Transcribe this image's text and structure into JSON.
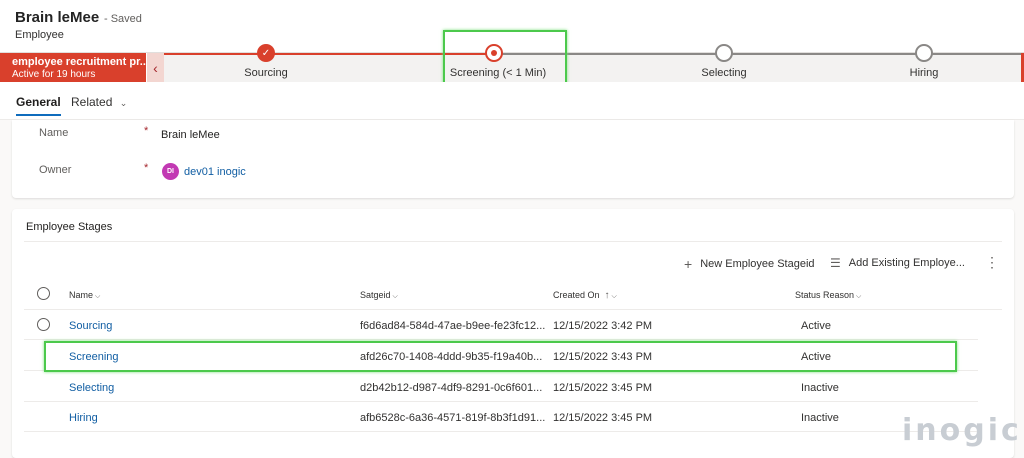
{
  "header": {
    "title": "Brain leMee",
    "saved": "- Saved",
    "entity": "Employee"
  },
  "bpf": {
    "process_name": "employee recruitment pr...",
    "active_for": "Active for 19 hours",
    "stages": [
      {
        "label": "Sourcing",
        "status": "completed"
      },
      {
        "label": "Screening  (< 1 Min)",
        "status": "active"
      },
      {
        "label": "Selecting",
        "status": "pending"
      },
      {
        "label": "Hiring",
        "status": "pending"
      }
    ],
    "colors": {
      "accent": "#d9402c",
      "pending": "#8a8886"
    }
  },
  "tabs": {
    "general": "General",
    "related": "Related"
  },
  "form": {
    "name_label": "Name",
    "name_value": "Brain leMee",
    "owner_label": "Owner",
    "owner_initials": "DI",
    "owner_value": "dev01 inogic",
    "required_mark": "*"
  },
  "subgrid": {
    "title": "Employee Stages",
    "commands": {
      "new": "New Employee Stageid",
      "add_existing": "Add Existing Employe..."
    },
    "columns": {
      "name": "Name",
      "satgeid": "Satgeid",
      "created_on": "Created On",
      "status_reason": "Status Reason"
    },
    "rows": [
      {
        "name": "Sourcing",
        "satgeid": "f6d6ad84-584d-47ae-b9ee-fe23fc12...",
        "created_on": "12/15/2022 3:42 PM",
        "status": "Active"
      },
      {
        "name": "Screening",
        "satgeid": "afd26c70-1408-4ddd-9b35-f19a40b...",
        "created_on": "12/15/2022 3:43 PM",
        "status": "Active"
      },
      {
        "name": "Selecting",
        "satgeid": "d2b42b12-d987-4df9-8291-0c6f601...",
        "created_on": "12/15/2022 3:45 PM",
        "status": "Inactive"
      },
      {
        "name": "Hiring",
        "satgeid": "afb6528c-6a36-4571-819f-8b3f1d91...",
        "created_on": "12/15/2022 3:45 PM",
        "status": "Inactive"
      }
    ]
  },
  "watermark": "inogic"
}
